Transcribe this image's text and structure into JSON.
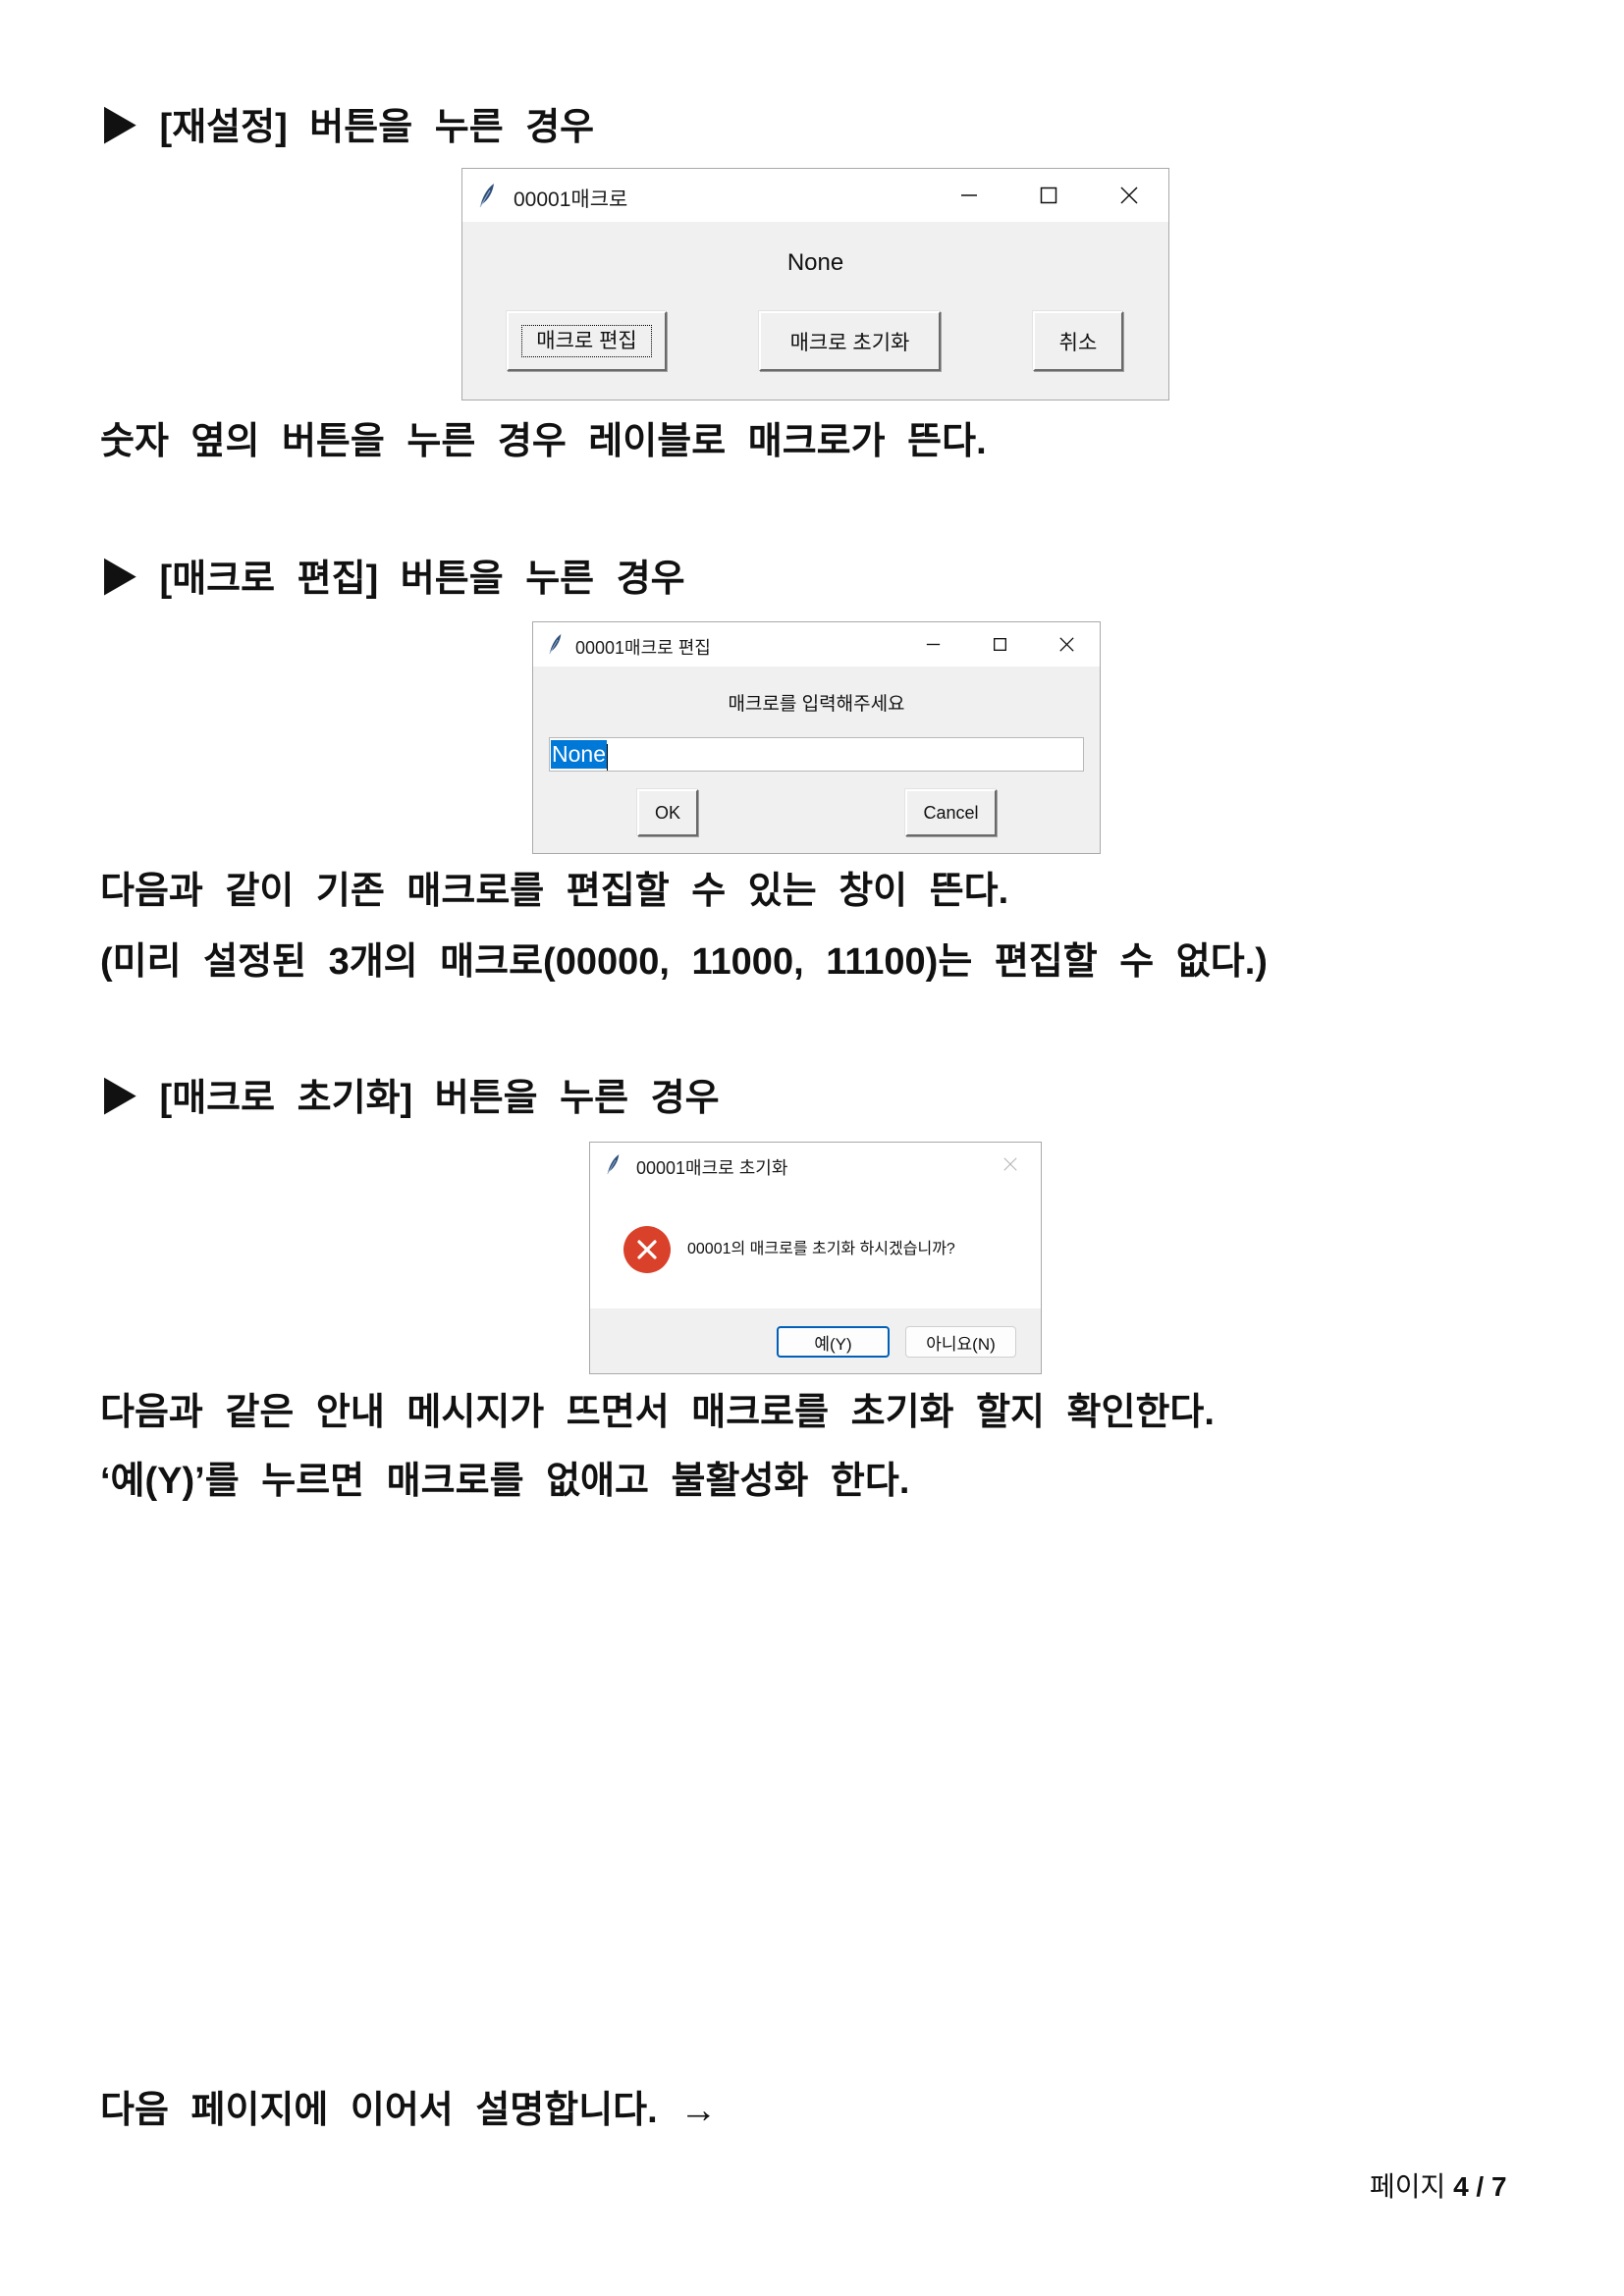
{
  "sections": [
    {
      "heading": "▶ [재설정] 버튼을 누른 경우",
      "captions": [
        "숫자 옆의 버튼을 누른 경우 레이블로 매크로가 뜬다."
      ]
    },
    {
      "heading": "▶ [매크로 편집] 버튼을 누른 경우",
      "captions": [
        "다음과 같이 기존 매크로를 편집할 수 있는 창이 뜬다.",
        "(미리 설정된 3개의 매크로(00000, 11000, 11100)는 편집할 수 없다.)"
      ]
    },
    {
      "heading": "▶ [매크로 초기화] 버튼을 누른 경우",
      "captions": [
        "다음과 같은 안내 메시지가 뜨면서 매크로를 초기화 할지 확인한다.",
        "‘예(Y)’를 누르면 매크로를 없애고 불활성화 한다."
      ]
    }
  ],
  "macro_window": {
    "title": "00001매크로",
    "app_icon": "feather-icon",
    "value_label": "None",
    "buttons": {
      "edit": "매크로 편집",
      "reset": "매크로 초기화",
      "cancel": "취소"
    }
  },
  "edit_dialog": {
    "title": "00001매크로 편집",
    "app_icon": "feather-icon",
    "prompt": "매크로를 입력해주세요",
    "input_value": "None",
    "ok": "OK",
    "cancel": "Cancel"
  },
  "reset_dialog": {
    "title": "00001매크로 초기화",
    "app_icon": "feather-icon",
    "status_icon": "error-icon",
    "message": "00001의 매크로를 초기화 하시겠습니까?",
    "yes": "예(Y)",
    "no": "아니요(N)"
  },
  "window_controls": {
    "minimize_icon": "minimize-icon",
    "maximize_icon": "maximize-icon",
    "close_icon": "close-icon"
  },
  "footer": {
    "next_note": "다음 페이지에 이어서 설명합니다. →",
    "page_label": "페이지",
    "current_page": "4",
    "separator": "/",
    "total_pages": "7"
  },
  "colors": {
    "selection": "#0078d7",
    "error_icon": "#d9412b",
    "default_button_border": "#005fb8",
    "dialog_body": "#f0f0f0"
  }
}
